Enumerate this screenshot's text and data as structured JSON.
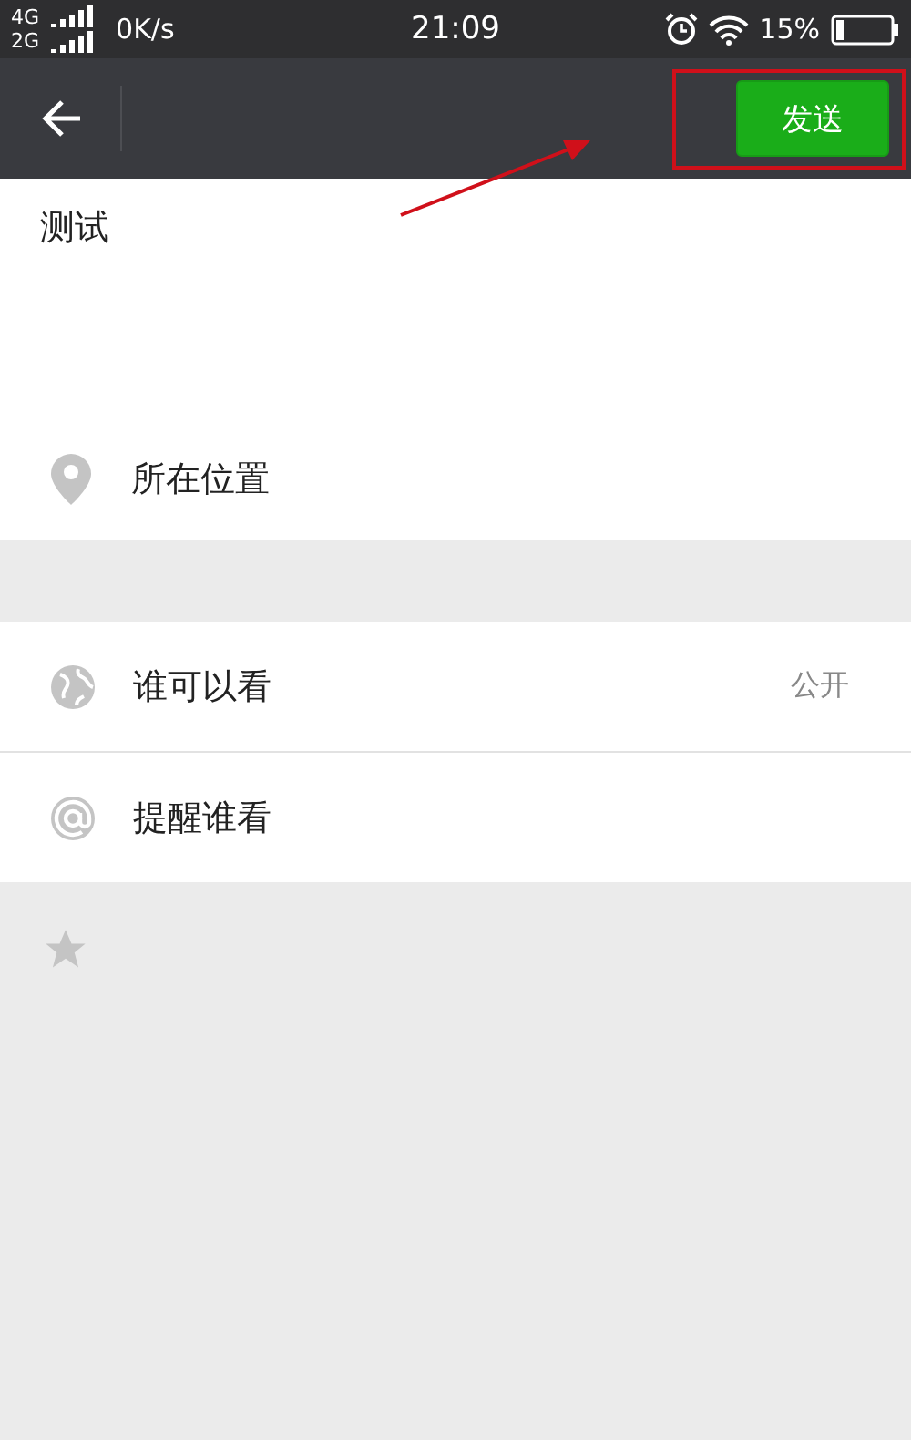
{
  "status_bar": {
    "network_top": "4G",
    "network_bottom": "2G",
    "speed": "0K/s",
    "time": "21:09",
    "battery": "15%"
  },
  "toolbar": {
    "send_button": "发送"
  },
  "post": {
    "text": "测试",
    "location": "所在位置"
  },
  "options": [
    {
      "kind": "visibility",
      "label": "谁可以看",
      "value": "公开"
    },
    {
      "kind": "mention",
      "label": "提醒谁看"
    }
  ]
}
